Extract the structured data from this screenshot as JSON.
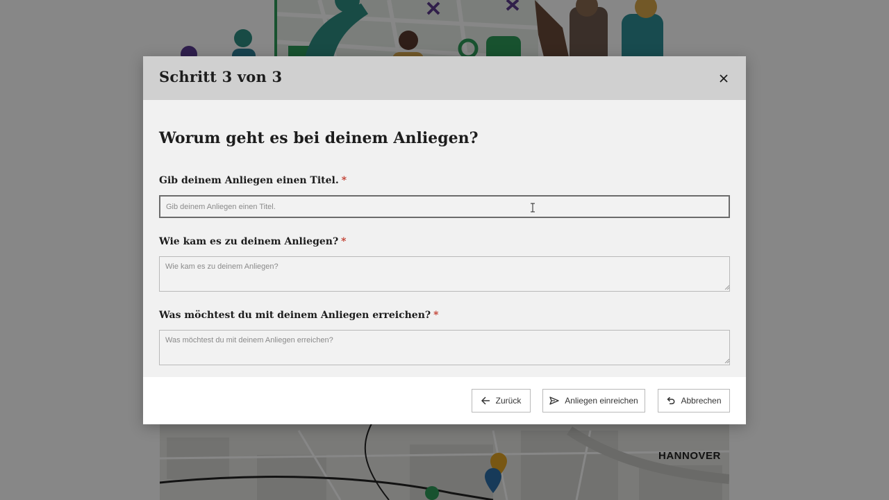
{
  "modal": {
    "title": "Schritt 3 von 3",
    "heading": "Worum geht es bei deinem Anliegen?",
    "fields": [
      {
        "label": "Gib deinem Anliegen einen Titel.",
        "required_mark": "*",
        "placeholder": "Gib deinem Anliegen einen Titel.",
        "value": ""
      },
      {
        "label": "Wie kam es zu deinem Anliegen?",
        "required_mark": "*",
        "placeholder": "Wie kam es zu deinem Anliegen?",
        "value": ""
      },
      {
        "label": "Was möchtest du mit deinem Anliegen erreichen?",
        "required_mark": "*",
        "placeholder": "Was möchtest du mit deinem Anliegen erreichen?",
        "value": ""
      }
    ],
    "buttons": {
      "back": "Zurück",
      "submit": "Anliegen einreichen",
      "cancel": "Abbrechen"
    },
    "icons": {
      "close": "close-icon",
      "back": "arrow-left-icon",
      "submit": "send-icon",
      "cancel": "undo-icon"
    }
  },
  "background": {
    "map_label": "HANNOVER"
  },
  "colors": {
    "overlay": "#000000",
    "header_bg": "#d0d0d0",
    "body_bg": "#f1f1f1",
    "required": "#c0392b",
    "accent_green": "#2e9c5a"
  }
}
